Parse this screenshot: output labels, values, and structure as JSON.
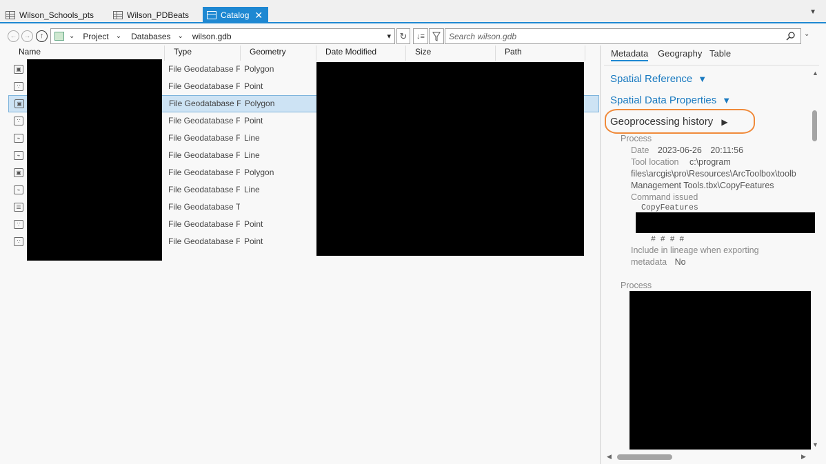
{
  "tabs": [
    {
      "label": "Wilson_Schools_pts",
      "icon": "table-icon",
      "active": false
    },
    {
      "label": "Wilson_PDBeats",
      "icon": "table-icon",
      "active": false
    },
    {
      "label": "Catalog",
      "icon": "catalog-icon",
      "active": true,
      "close": "✕"
    }
  ],
  "tab_overflow": "▼",
  "toolbar": {
    "back": "←",
    "forward": "→",
    "up": "↑",
    "breadcrumb": [
      "Project",
      "Databases",
      "wilson.gdb"
    ],
    "separator": "⌄",
    "dropdown": "▾",
    "refresh": "↻",
    "sort": "↓≡",
    "filter": "⛉",
    "search_placeholder": "Search wilson.gdb",
    "search_icon": "⚲",
    "search_dropdown": "⌄"
  },
  "columns": [
    "Name",
    "Type",
    "Geometry",
    "Date Modified",
    "Size",
    "Path"
  ],
  "rows": [
    {
      "icon": "polygon-fc-icon",
      "type": "File Geodatabase F",
      "geometry": "Polygon",
      "selected": false
    },
    {
      "icon": "point-fc-icon",
      "type": "File Geodatabase F",
      "geometry": "Point",
      "selected": false
    },
    {
      "icon": "polygon-fc-icon",
      "type": "File Geodatabase F",
      "geometry": "Polygon",
      "selected": true
    },
    {
      "icon": "point-fc-icon",
      "type": "File Geodatabase F",
      "geometry": "Point",
      "selected": false
    },
    {
      "icon": "line-fc-icon",
      "type": "File Geodatabase F",
      "geometry": "Line",
      "selected": false
    },
    {
      "icon": "line-fc-icon",
      "type": "File Geodatabase F",
      "geometry": "Line",
      "selected": false
    },
    {
      "icon": "polygon-fc-icon",
      "type": "File Geodatabase F",
      "geometry": "Polygon",
      "selected": false
    },
    {
      "icon": "line-fc-icon",
      "type": "File Geodatabase F",
      "geometry": "Line",
      "selected": false
    },
    {
      "icon": "table-icon",
      "type": "File Geodatabase T",
      "geometry": "",
      "selected": false
    },
    {
      "icon": "point-fc-icon",
      "type": "File Geodatabase F",
      "geometry": "Point",
      "selected": false
    },
    {
      "icon": "point-fc-icon",
      "type": "File Geodatabase F",
      "geometry": "Point",
      "selected": false
    }
  ],
  "right_tabs": [
    "Metadata",
    "Geography",
    "Table"
  ],
  "metadata": {
    "spatial_reference": "Spatial Reference",
    "spatial_data_properties": "Spatial Data Properties",
    "expanded_arrow": "▼",
    "geoprocessing_history": "Geoprocessing history",
    "collapsed_arrow": "▶",
    "process_label": "Process",
    "date_label": "Date",
    "date_value": "2023-06-26",
    "time_value": "20:11:56",
    "tool_location_label": "Tool location",
    "tool_location_line1": "c:\\program",
    "tool_location_line2": "files\\arcgis\\pro\\Resources\\ArcToolbox\\toolb",
    "tool_location_line3": "Management Tools.tbx\\CopyFeatures",
    "command_issued_label": "Command issued",
    "command_value": "CopyFeatures",
    "command_tail": "# # # #",
    "lineage_label_line1": "Include in lineage when exporting",
    "lineage_label_line2": "metadata",
    "lineage_value": "No",
    "process2_label": "Process"
  },
  "scroll": {
    "up": "▲",
    "down": "▼",
    "left": "◀",
    "right": "▶"
  }
}
